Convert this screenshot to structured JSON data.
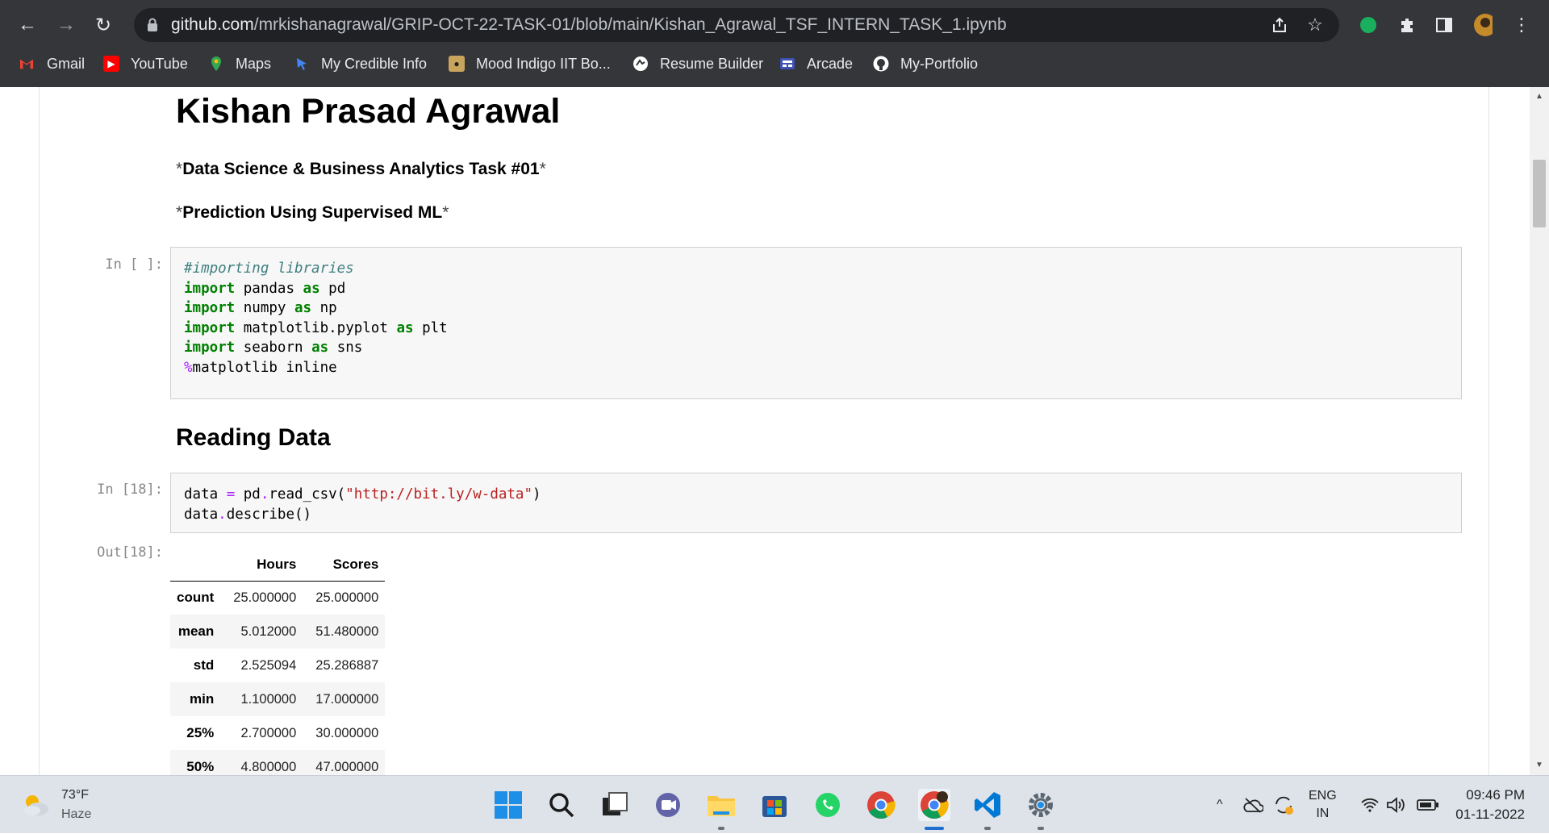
{
  "browser": {
    "url_host": "github.com",
    "url_path": "/mrkishanagrawal/GRIP-OCT-22-TASK-01/blob/main/Kishan_Agrawal_TSF_INTERN_TASK_1.ipynb",
    "bookmarks": [
      {
        "label": "Gmail",
        "icon": "gmail-icon",
        "color": "#ea4335"
      },
      {
        "label": "YouTube",
        "icon": "youtube-icon",
        "color": "#ff0000"
      },
      {
        "label": "Maps",
        "icon": "maps-icon",
        "color": "#34a853"
      },
      {
        "label": "My Credible Info",
        "icon": "credible-icon",
        "color": "#4285f4"
      },
      {
        "label": "Mood Indigo IIT Bo...",
        "icon": "mood-indigo-icon",
        "color": "#222222"
      },
      {
        "label": "Resume Builder",
        "icon": "resume-builder-icon",
        "color": "#ffffff"
      },
      {
        "label": "Arcade",
        "icon": "arcade-icon",
        "color": "#3f51b5"
      },
      {
        "label": "My-Portfolio",
        "icon": "github-icon",
        "color": "#ffffff"
      }
    ]
  },
  "notebook": {
    "title": "Kishan Prasad Agrawal",
    "subtitle1": "Data Science & Business Analytics Task #01",
    "subtitle2": "Prediction Using Supervised ML",
    "asterisk": "*",
    "cell1": {
      "prompt": "In [ ]:",
      "comment": "#importing libraries",
      "lines": [
        {
          "kw": "import",
          "mod": "pandas",
          "alias": "pd"
        },
        {
          "kw": "import",
          "mod": "numpy",
          "alias": "np"
        },
        {
          "kw": "import",
          "mod": "matplotlib.pyplot",
          "alias": "plt"
        },
        {
          "kw": "import",
          "mod": "seaborn",
          "alias": "sns"
        }
      ],
      "as_kw": "as",
      "magic_pct": "%",
      "magic": "matplotlib inline"
    },
    "heading2": "Reading Data",
    "cell2": {
      "prompt": "In [18]:",
      "line1_a": "data ",
      "line1_eq": "=",
      "line1_b": " pd",
      "line1_dot": ".",
      "line1_c": "read_csv(",
      "line1_str": "\"http://bit.ly/w-data\"",
      "line1_d": ")",
      "line2_a": "data",
      "line2_dot": ".",
      "line2_b": "describe()"
    },
    "output": {
      "prompt": "Out[18]:",
      "columns": [
        "Hours",
        "Scores"
      ],
      "rows": [
        {
          "label": "count",
          "values": [
            "25.000000",
            "25.000000"
          ]
        },
        {
          "label": "mean",
          "values": [
            "5.012000",
            "51.480000"
          ]
        },
        {
          "label": "std",
          "values": [
            "2.525094",
            "25.286887"
          ]
        },
        {
          "label": "min",
          "values": [
            "1.100000",
            "17.000000"
          ]
        },
        {
          "label": "25%",
          "values": [
            "2.700000",
            "30.000000"
          ]
        },
        {
          "label": "50%",
          "values": [
            "4.800000",
            "47.000000"
          ]
        }
      ]
    }
  },
  "taskbar": {
    "weather_temp": "73°F",
    "weather_desc": "Haze",
    "lang_top": "ENG",
    "lang_bottom": "IN",
    "time": "09:46 PM",
    "date": "01-11-2022"
  }
}
